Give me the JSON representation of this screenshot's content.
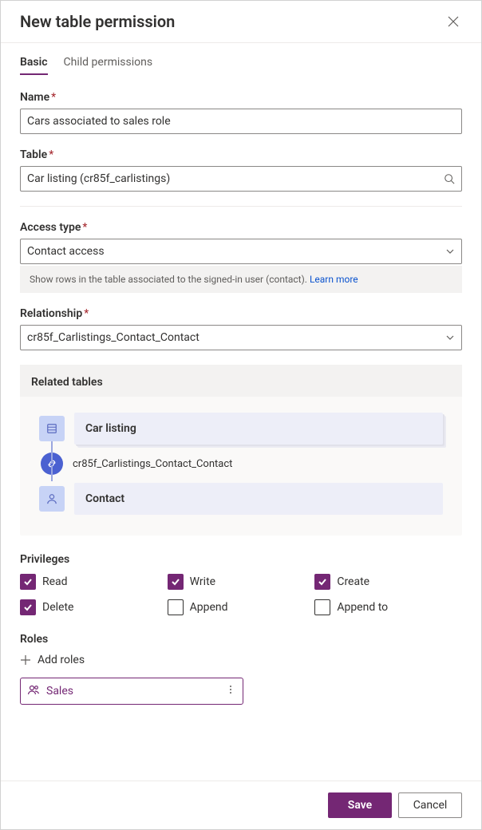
{
  "header": {
    "title": "New table permission"
  },
  "tabs": [
    {
      "label": "Basic",
      "active": true
    },
    {
      "label": "Child permissions",
      "active": false
    }
  ],
  "fields": {
    "name": {
      "label": "Name",
      "value": "Cars associated to sales role"
    },
    "table": {
      "label": "Table",
      "value": "Car listing (cr85f_carlistings)"
    },
    "access_type": {
      "label": "Access type",
      "value": "Contact access"
    },
    "access_type_info": {
      "text": "Show rows in the table associated to the signed-in user (contact).",
      "link": "Learn more"
    },
    "relationship": {
      "label": "Relationship",
      "value": "cr85f_Carlistings_Contact_Contact"
    }
  },
  "related": {
    "heading": "Related tables",
    "entity_top": "Car listing",
    "relation": "cr85f_Carlistings_Contact_Contact",
    "entity_bottom": "Contact"
  },
  "privileges": {
    "heading": "Privileges",
    "items": [
      {
        "label": "Read",
        "checked": true
      },
      {
        "label": "Write",
        "checked": true
      },
      {
        "label": "Create",
        "checked": true
      },
      {
        "label": "Delete",
        "checked": true
      },
      {
        "label": "Append",
        "checked": false
      },
      {
        "label": "Append to",
        "checked": false
      }
    ]
  },
  "roles": {
    "heading": "Roles",
    "add_label": "Add roles",
    "items": [
      {
        "name": "Sales"
      }
    ]
  },
  "footer": {
    "save": "Save",
    "cancel": "Cancel"
  }
}
